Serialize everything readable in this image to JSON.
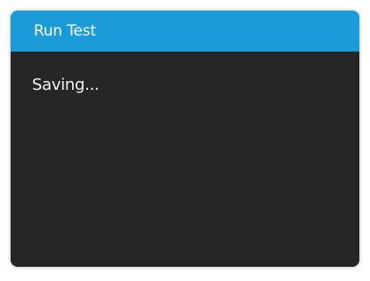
{
  "dialog": {
    "title": "Run Test",
    "status_text": "Saving..."
  },
  "colors": {
    "titlebar_bg": "#1a9bd7",
    "body_bg": "#262626",
    "text": "#ffffff"
  }
}
